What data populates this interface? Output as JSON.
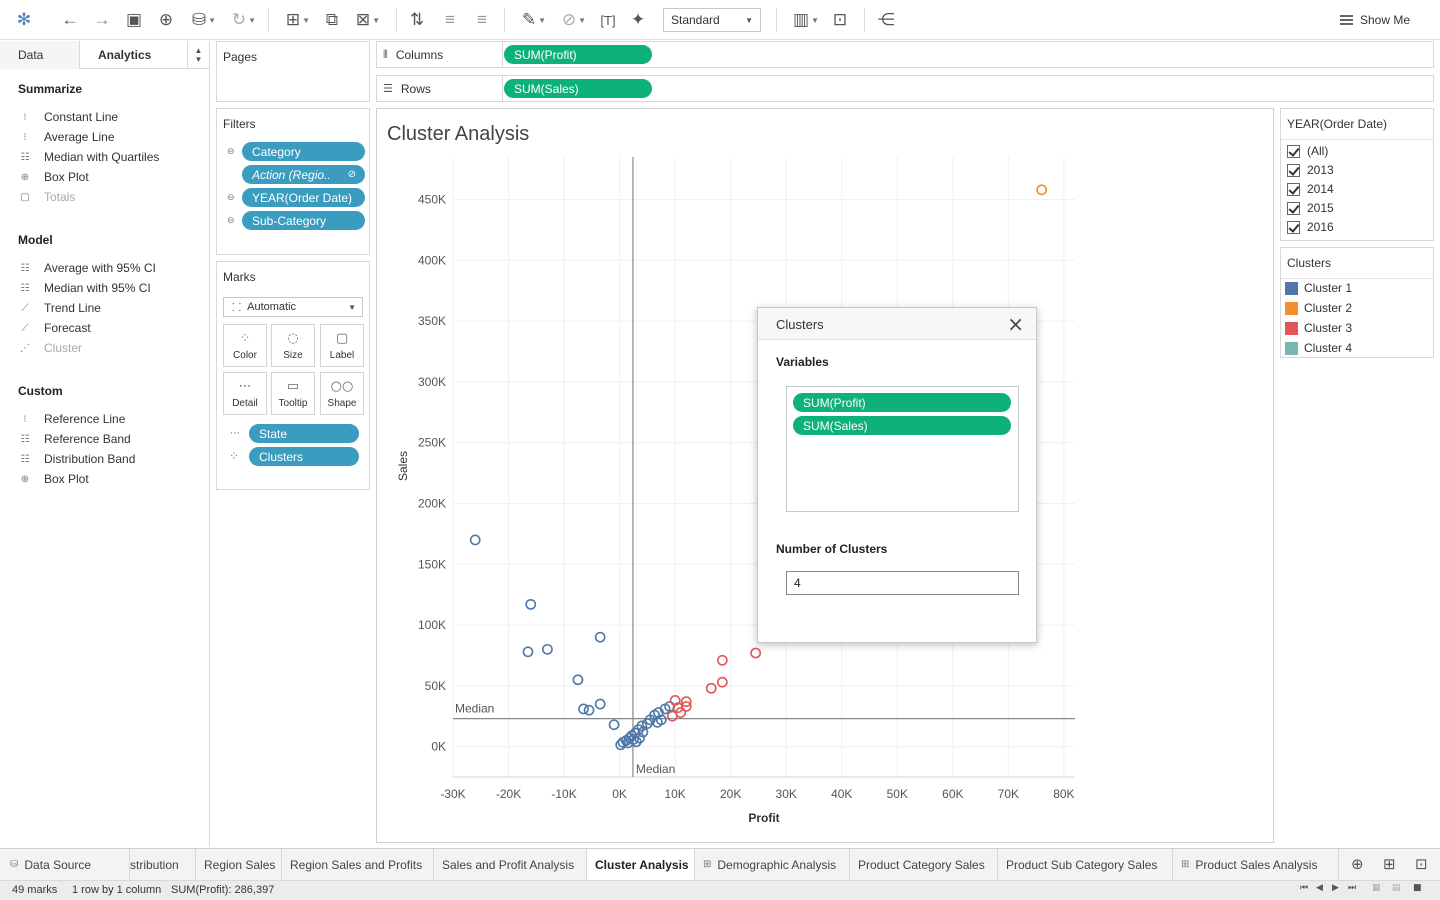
{
  "toolbar": {
    "standard_select": "Standard",
    "show_me": "Show Me",
    "icons": [
      "tableau-logo-icon",
      "undo-icon",
      "redo-icon",
      "save-icon",
      "new-datasource-icon",
      "pause-updates-icon",
      "refresh-icon",
      "new-worksheet-icon",
      "duplicate-icon",
      "clear-sheet-icon",
      "swap-icon",
      "sort-asc-icon",
      "sort-desc-icon",
      "highlight-icon",
      "group-icon",
      "label-icon",
      "pin-icon",
      "fit-icon",
      "presentation-icon",
      "share-icon"
    ]
  },
  "left_pane": {
    "tab_data": "Data",
    "tab_analytics": "Analytics",
    "summarize": {
      "title": "Summarize",
      "items": [
        {
          "label": "Constant Line",
          "enabled": true
        },
        {
          "label": "Average Line",
          "enabled": true
        },
        {
          "label": "Median with Quartiles",
          "enabled": true
        },
        {
          "label": "Box Plot",
          "enabled": true
        },
        {
          "label": "Totals",
          "enabled": false
        }
      ]
    },
    "model": {
      "title": "Model",
      "items": [
        {
          "label": "Average with 95% CI",
          "enabled": true
        },
        {
          "label": "Median with 95% CI",
          "enabled": true
        },
        {
          "label": "Trend Line",
          "enabled": true
        },
        {
          "label": "Forecast",
          "enabled": true
        },
        {
          "label": "Cluster",
          "enabled": false
        }
      ]
    },
    "custom": {
      "title": "Custom",
      "items": [
        {
          "label": "Reference Line",
          "enabled": true
        },
        {
          "label": "Reference Band",
          "enabled": true
        },
        {
          "label": "Distribution Band",
          "enabled": true
        },
        {
          "label": "Box Plot",
          "enabled": true
        }
      ]
    }
  },
  "pages": {
    "title": "Pages"
  },
  "filters": {
    "title": "Filters",
    "items": [
      "Category",
      "Action (Regio..",
      "YEAR(Order Date)",
      "Sub-Category"
    ]
  },
  "marks": {
    "title": "Marks",
    "type": "Automatic",
    "buttons": [
      "Color",
      "Size",
      "Label",
      "Detail",
      "Tooltip",
      "Shape"
    ],
    "fields": [
      "State",
      "Clusters"
    ]
  },
  "shelves": {
    "columns_label": "Columns",
    "columns_pill": "SUM(Profit)",
    "rows_label": "Rows",
    "rows_pill": "SUM(Sales)"
  },
  "viz": {
    "title": "Cluster Analysis",
    "median_label_h": "Median",
    "median_label_v": "Median"
  },
  "chart_data": {
    "type": "scatter",
    "title": "Cluster Analysis",
    "xlabel": "Profit",
    "ylabel": "Sales",
    "xlim": [
      -30000,
      82000
    ],
    "ylim": [
      -25000,
      485000
    ],
    "x_ticks": [
      -30000,
      -20000,
      -10000,
      0,
      10000,
      20000,
      30000,
      40000,
      50000,
      60000,
      70000,
      80000
    ],
    "x_tick_labels": [
      "-30K",
      "-20K",
      "-10K",
      "0K",
      "10K",
      "20K",
      "30K",
      "40K",
      "50K",
      "60K",
      "70K",
      "80K"
    ],
    "y_ticks": [
      0,
      50000,
      100000,
      150000,
      200000,
      250000,
      300000,
      350000,
      400000,
      450000
    ],
    "y_tick_labels": [
      "0K",
      "50K",
      "100K",
      "150K",
      "200K",
      "250K",
      "300K",
      "350K",
      "400K",
      "450K"
    ],
    "median_x": 2400,
    "median_y": 23000,
    "grid": true,
    "series": [
      {
        "name": "Cluster 1",
        "color": "#4e79a7",
        "points": [
          [
            -26000,
            170000
          ],
          [
            -16000,
            117000
          ],
          [
            -16500,
            78000
          ],
          [
            -13000,
            80000
          ],
          [
            -3500,
            90000
          ],
          [
            -7500,
            55000
          ],
          [
            -6500,
            31000
          ],
          [
            -5500,
            30000
          ],
          [
            -3500,
            35000
          ],
          [
            -1000,
            18000
          ],
          [
            200,
            1500
          ],
          [
            600,
            3500
          ],
          [
            1200,
            5000
          ],
          [
            1800,
            7000
          ],
          [
            2200,
            9000
          ],
          [
            2800,
            11000
          ],
          [
            3400,
            14000
          ],
          [
            4000,
            17000
          ],
          [
            3000,
            4000
          ],
          [
            3600,
            7000
          ],
          [
            4200,
            12000
          ],
          [
            5000,
            19000
          ],
          [
            5500,
            22000
          ],
          [
            6300,
            26000
          ],
          [
            6800,
            20000
          ],
          [
            7500,
            22000
          ],
          [
            8200,
            31000
          ],
          [
            9000,
            33000
          ],
          [
            7000,
            28000
          ],
          [
            1500,
            3000
          ],
          [
            2500,
            6000
          ]
        ]
      },
      {
        "name": "Cluster 2",
        "color": "#f28e2b",
        "points": [
          [
            76000,
            458000
          ]
        ]
      },
      {
        "name": "Cluster 3",
        "color": "#e15759",
        "points": [
          [
            10000,
            38000
          ],
          [
            10500,
            32000
          ],
          [
            11000,
            28000
          ],
          [
            12000,
            37000
          ],
          [
            12000,
            33000
          ],
          [
            16500,
            48000
          ],
          [
            18500,
            53000
          ],
          [
            18500,
            71000
          ],
          [
            24500,
            77000
          ],
          [
            9500,
            25000
          ]
        ]
      },
      {
        "name": "Cluster 4",
        "color": "#76b7b2",
        "points": []
      }
    ]
  },
  "year_legend": {
    "title": "YEAR(Order Date)",
    "items": [
      "(All)",
      "2013",
      "2014",
      "2015",
      "2016"
    ]
  },
  "clusters_legend": {
    "title": "Clusters",
    "items": [
      {
        "label": "Cluster 1",
        "color": "#4e79a7"
      },
      {
        "label": "Cluster 2",
        "color": "#f28e2b"
      },
      {
        "label": "Cluster 3",
        "color": "#e15759"
      },
      {
        "label": "Cluster 4",
        "color": "#76b7b2"
      }
    ]
  },
  "dialog": {
    "title": "Clusters",
    "variables_label": "Variables",
    "variables": [
      "SUM(Profit)",
      "SUM(Sales)"
    ],
    "number_label": "Number of Clusters",
    "number_value": "4"
  },
  "sheet_tabs": {
    "data_source": "Data Source",
    "tabs": [
      "stribution",
      "Region Sales",
      "Region Sales and Profits",
      "Sales and Profit Analysis",
      "Cluster Analysis",
      "Demographic Analysis",
      "Product Category Sales",
      "Product Sub Category Sales",
      "Product Sales Analysis"
    ],
    "active": "Cluster Analysis"
  },
  "status_bar": {
    "marks": "49 marks",
    "rows_cols": "1 row by 1 column",
    "sum": "SUM(Profit): 286,397"
  }
}
